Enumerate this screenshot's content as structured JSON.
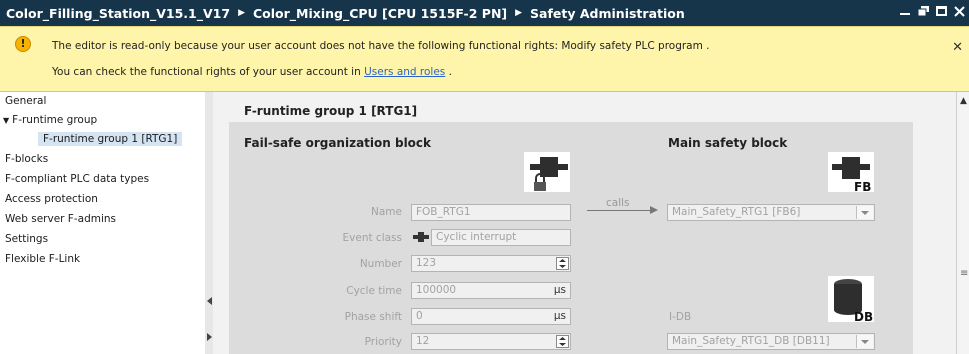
{
  "titlebar": {
    "crumbs": [
      "Color_Filling_Station_V15.1_V17",
      "Color_Mixing_CPU [CPU 1515F-2 PN]",
      "Safety Administration"
    ]
  },
  "warning": {
    "line1": "The editor is read-only because your user account does not have the following functional rights: Modify safety PLC program .",
    "line2_prefix": "You can check the functional rights of your user account in ",
    "line2_link": "Users and roles",
    "line2_suffix": " ."
  },
  "nav": {
    "items": [
      {
        "label": "General"
      },
      {
        "label": "F-runtime group"
      },
      {
        "label": "F-runtime group 1 [RTG1]"
      },
      {
        "label": "F-blocks"
      },
      {
        "label": "F-compliant PLC data types"
      },
      {
        "label": "Access protection"
      },
      {
        "label": "Web server F-admins"
      },
      {
        "label": "Settings"
      },
      {
        "label": "Flexible F-Link"
      }
    ]
  },
  "content": {
    "group_title": "F-runtime group 1 [RTG1]",
    "fob": {
      "title": "Fail-safe organization block",
      "name_label": "Name",
      "name_value": "FOB_RTG1",
      "event_label": "Event class",
      "event_value": "Cyclic interrupt",
      "number_label": "Number",
      "number_value": "123",
      "cycle_label": "Cycle time",
      "cycle_value": "100000",
      "cycle_unit": "µs",
      "phase_label": "Phase shift",
      "phase_value": "0",
      "phase_unit": "µs",
      "priority_label": "Priority",
      "priority_value": "12"
    },
    "calls_label": "calls",
    "main": {
      "title": "Main safety block",
      "block_value": "Main_Safety_RTG1 [FB6]",
      "fb_badge": "FB",
      "idb_label": "I-DB",
      "idb_value": "Main_Safety_RTG1_DB [DB11]",
      "db_badge": "DB"
    }
  },
  "colors": {
    "titlebar": "#16344a",
    "warning_bg": "#fff5aa",
    "selected_nav": "#d5e4f2",
    "panel": "#dcdcdc"
  }
}
